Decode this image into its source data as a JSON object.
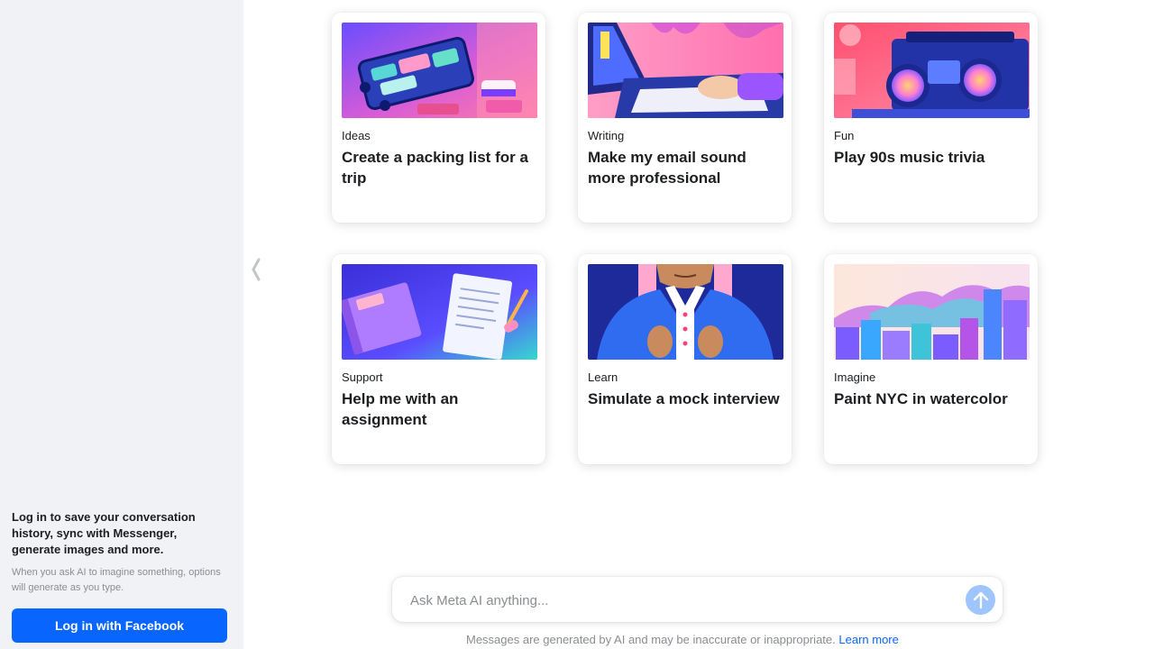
{
  "sidebar": {
    "login_prompt": "Log in to save your conversation history, sync with Messenger, generate images and more.",
    "login_note": "When you ask AI to imagine something, options will generate as you type.",
    "login_button": "Log in with Facebook"
  },
  "suggestions": [
    {
      "category": "Ideas",
      "title": "Create a packing list for a trip",
      "image": "suitcase-illustration"
    },
    {
      "category": "Writing",
      "title": "Make my email sound more professional",
      "image": "laptop-illustration"
    },
    {
      "category": "Fun",
      "title": "Play 90s music trivia",
      "image": "boombox-illustration"
    },
    {
      "category": "Support",
      "title": "Help me with an assignment",
      "image": "notebook-illustration"
    },
    {
      "category": "Learn",
      "title": "Simulate a mock interview",
      "image": "blazer-illustration"
    },
    {
      "category": "Imagine",
      "title": "Paint NYC in watercolor",
      "image": "city-watercolor-illustration"
    }
  ],
  "composer": {
    "placeholder": "Ask Meta AI anything...",
    "send_icon": "arrow-up-icon"
  },
  "footer": {
    "disclaimer": "Messages are generated by AI and may be inaccurate or inappropriate.",
    "learn_more": "Learn more"
  },
  "colors": {
    "accent": "#0866ff",
    "sidebar_bg": "#f1f2f5",
    "send_button": "#9ec5fe"
  }
}
